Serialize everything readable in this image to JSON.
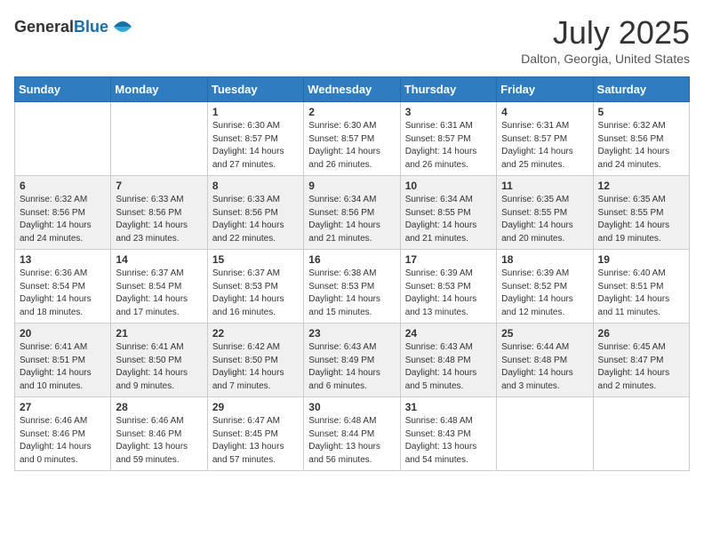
{
  "header": {
    "logo_general": "General",
    "logo_blue": "Blue",
    "month_title": "July 2025",
    "subtitle": "Dalton, Georgia, United States"
  },
  "days_of_week": [
    "Sunday",
    "Monday",
    "Tuesday",
    "Wednesday",
    "Thursday",
    "Friday",
    "Saturday"
  ],
  "weeks": [
    [
      {
        "day": "",
        "info": ""
      },
      {
        "day": "",
        "info": ""
      },
      {
        "day": "1",
        "info": "Sunrise: 6:30 AM\nSunset: 8:57 PM\nDaylight: 14 hours and 27 minutes."
      },
      {
        "day": "2",
        "info": "Sunrise: 6:30 AM\nSunset: 8:57 PM\nDaylight: 14 hours and 26 minutes."
      },
      {
        "day": "3",
        "info": "Sunrise: 6:31 AM\nSunset: 8:57 PM\nDaylight: 14 hours and 26 minutes."
      },
      {
        "day": "4",
        "info": "Sunrise: 6:31 AM\nSunset: 8:57 PM\nDaylight: 14 hours and 25 minutes."
      },
      {
        "day": "5",
        "info": "Sunrise: 6:32 AM\nSunset: 8:56 PM\nDaylight: 14 hours and 24 minutes."
      }
    ],
    [
      {
        "day": "6",
        "info": "Sunrise: 6:32 AM\nSunset: 8:56 PM\nDaylight: 14 hours and 24 minutes."
      },
      {
        "day": "7",
        "info": "Sunrise: 6:33 AM\nSunset: 8:56 PM\nDaylight: 14 hours and 23 minutes."
      },
      {
        "day": "8",
        "info": "Sunrise: 6:33 AM\nSunset: 8:56 PM\nDaylight: 14 hours and 22 minutes."
      },
      {
        "day": "9",
        "info": "Sunrise: 6:34 AM\nSunset: 8:56 PM\nDaylight: 14 hours and 21 minutes."
      },
      {
        "day": "10",
        "info": "Sunrise: 6:34 AM\nSunset: 8:55 PM\nDaylight: 14 hours and 21 minutes."
      },
      {
        "day": "11",
        "info": "Sunrise: 6:35 AM\nSunset: 8:55 PM\nDaylight: 14 hours and 20 minutes."
      },
      {
        "day": "12",
        "info": "Sunrise: 6:35 AM\nSunset: 8:55 PM\nDaylight: 14 hours and 19 minutes."
      }
    ],
    [
      {
        "day": "13",
        "info": "Sunrise: 6:36 AM\nSunset: 8:54 PM\nDaylight: 14 hours and 18 minutes."
      },
      {
        "day": "14",
        "info": "Sunrise: 6:37 AM\nSunset: 8:54 PM\nDaylight: 14 hours and 17 minutes."
      },
      {
        "day": "15",
        "info": "Sunrise: 6:37 AM\nSunset: 8:53 PM\nDaylight: 14 hours and 16 minutes."
      },
      {
        "day": "16",
        "info": "Sunrise: 6:38 AM\nSunset: 8:53 PM\nDaylight: 14 hours and 15 minutes."
      },
      {
        "day": "17",
        "info": "Sunrise: 6:39 AM\nSunset: 8:53 PM\nDaylight: 14 hours and 13 minutes."
      },
      {
        "day": "18",
        "info": "Sunrise: 6:39 AM\nSunset: 8:52 PM\nDaylight: 14 hours and 12 minutes."
      },
      {
        "day": "19",
        "info": "Sunrise: 6:40 AM\nSunset: 8:51 PM\nDaylight: 14 hours and 11 minutes."
      }
    ],
    [
      {
        "day": "20",
        "info": "Sunrise: 6:41 AM\nSunset: 8:51 PM\nDaylight: 14 hours and 10 minutes."
      },
      {
        "day": "21",
        "info": "Sunrise: 6:41 AM\nSunset: 8:50 PM\nDaylight: 14 hours and 9 minutes."
      },
      {
        "day": "22",
        "info": "Sunrise: 6:42 AM\nSunset: 8:50 PM\nDaylight: 14 hours and 7 minutes."
      },
      {
        "day": "23",
        "info": "Sunrise: 6:43 AM\nSunset: 8:49 PM\nDaylight: 14 hours and 6 minutes."
      },
      {
        "day": "24",
        "info": "Sunrise: 6:43 AM\nSunset: 8:48 PM\nDaylight: 14 hours and 5 minutes."
      },
      {
        "day": "25",
        "info": "Sunrise: 6:44 AM\nSunset: 8:48 PM\nDaylight: 14 hours and 3 minutes."
      },
      {
        "day": "26",
        "info": "Sunrise: 6:45 AM\nSunset: 8:47 PM\nDaylight: 14 hours and 2 minutes."
      }
    ],
    [
      {
        "day": "27",
        "info": "Sunrise: 6:46 AM\nSunset: 8:46 PM\nDaylight: 14 hours and 0 minutes."
      },
      {
        "day": "28",
        "info": "Sunrise: 6:46 AM\nSunset: 8:46 PM\nDaylight: 13 hours and 59 minutes."
      },
      {
        "day": "29",
        "info": "Sunrise: 6:47 AM\nSunset: 8:45 PM\nDaylight: 13 hours and 57 minutes."
      },
      {
        "day": "30",
        "info": "Sunrise: 6:48 AM\nSunset: 8:44 PM\nDaylight: 13 hours and 56 minutes."
      },
      {
        "day": "31",
        "info": "Sunrise: 6:48 AM\nSunset: 8:43 PM\nDaylight: 13 hours and 54 minutes."
      },
      {
        "day": "",
        "info": ""
      },
      {
        "day": "",
        "info": ""
      }
    ]
  ]
}
